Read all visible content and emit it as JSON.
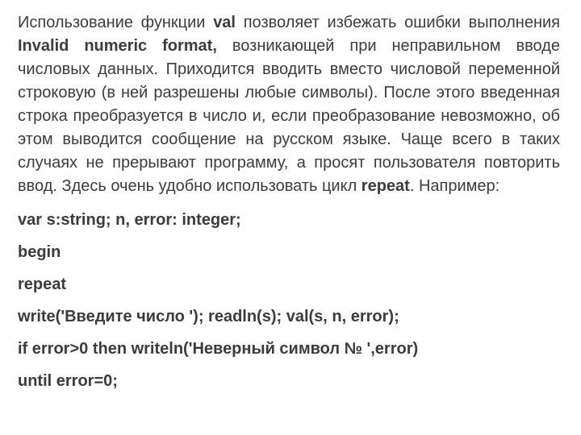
{
  "para": {
    "t1": "Использование функции ",
    "b1": "val",
    "t2": " позволяет избежать ошибки выполнения ",
    "b2": "Invalid numeric format,",
    "t3": " возникающей при неправильном вводе числовых данных. Приходится вводить вместо числовой переменной строковую (в ней разрешены любые символы). После этого введенная строка преобразуется в число и, если преобразование невозможно, об этом выводится сообщение на русском языке. Чаще всего в таких случаях не прерывают программу, а просят пользователя повторить ввод. Здесь очень удобно использовать цикл ",
    "b3": "repeat",
    "t4": ". Например:"
  },
  "code": {
    "l1": "var s:string; n, error: integer;",
    "l2": "begin",
    "l3": "repeat",
    "l4": "write('Введите число ');  readln(s);  val(s, n, error);",
    "l5": "if error>0 then writeln('Неверный символ № ',error)",
    "l6": "until error=0;"
  }
}
